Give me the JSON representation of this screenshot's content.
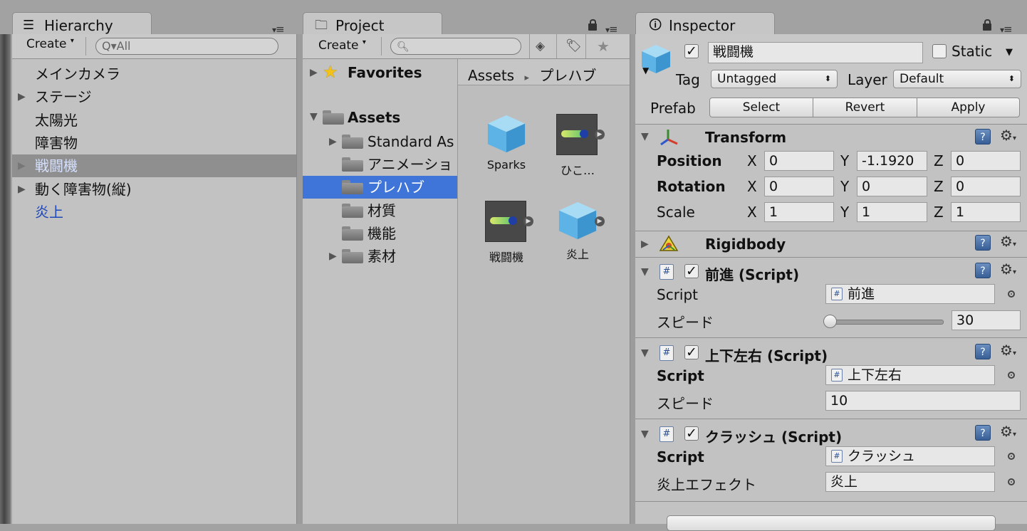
{
  "hierarchy": {
    "tab_title": "Hierarchy",
    "create_label": "Create",
    "search_placeholder": "All",
    "items": [
      {
        "label": "メインカメラ",
        "expandable": false,
        "selected": false
      },
      {
        "label": "ステージ",
        "expandable": true,
        "selected": false
      },
      {
        "label": "太陽光",
        "expandable": false,
        "selected": false
      },
      {
        "label": "障害物",
        "expandable": false,
        "selected": false
      },
      {
        "label": "戦闘機",
        "expandable": true,
        "selected": true
      },
      {
        "label": "動く障害物(縦)",
        "expandable": true,
        "selected": false
      },
      {
        "label": "炎上",
        "expandable": false,
        "selected": false
      }
    ]
  },
  "project": {
    "tab_title": "Project",
    "create_label": "Create",
    "favorites_label": "Favorites",
    "assets_label": "Assets",
    "folders": [
      {
        "label": "Standard As",
        "expandable": true
      },
      {
        "label": "アニメーショ",
        "expandable": false
      },
      {
        "label": "プレハブ",
        "expandable": false,
        "selected": true
      },
      {
        "label": "材質",
        "expandable": false
      },
      {
        "label": "機能",
        "expandable": false
      },
      {
        "label": "素材",
        "expandable": true
      }
    ],
    "breadcrumb": {
      "root": "Assets",
      "separator": "▸",
      "current": "プレハブ"
    },
    "asset_items": [
      {
        "label": "Sparks",
        "kind": "cube"
      },
      {
        "label": "ひこ…",
        "kind": "plane"
      },
      {
        "label": "戦闘機",
        "kind": "plane"
      },
      {
        "label": "炎上",
        "kind": "cube"
      }
    ]
  },
  "inspector": {
    "tab_title": "Inspector",
    "object_name": "戦闘機",
    "active": true,
    "static_label": "Static",
    "tag_label": "Tag",
    "tag_value": "Untagged",
    "layer_label": "Layer",
    "layer_value": "Default",
    "prefab_label": "Prefab",
    "prefab_buttons": {
      "select": "Select",
      "revert": "Revert",
      "apply": "Apply"
    },
    "transform": {
      "title": "Transform",
      "position_label": "Position",
      "rotation_label": "Rotation",
      "scale_label": "Scale",
      "x": "X",
      "y": "Y",
      "z": "Z",
      "position": {
        "x": "0",
        "y": "-1.1920",
        "z": "0"
      },
      "rotation": {
        "x": "0",
        "y": "0",
        "z": "0"
      },
      "scale": {
        "x": "1",
        "y": "1",
        "z": "1"
      }
    },
    "rigidbody": {
      "title": "Rigidbody"
    },
    "scripts": [
      {
        "title": "前進 (Script)",
        "script_label": "Script",
        "script_value": "前進",
        "prop_label": "スピード",
        "prop_value": "30",
        "slider": true
      },
      {
        "title": "上下左右 (Script)",
        "script_label": "Script",
        "script_value": "上下左右",
        "prop_label": "スピード",
        "prop_value": "10",
        "slider": false
      },
      {
        "title": "クラッシュ (Script)",
        "script_label": "Script",
        "script_value": "クラッシュ",
        "prop_label": "炎上エフェクト",
        "prop_value": "炎上",
        "slider": false
      }
    ]
  },
  "colors": {
    "selection": "#3f74d8",
    "hierarchy_selected_bg": "#8f8f8f",
    "prefab_text": "#1d46b8"
  }
}
